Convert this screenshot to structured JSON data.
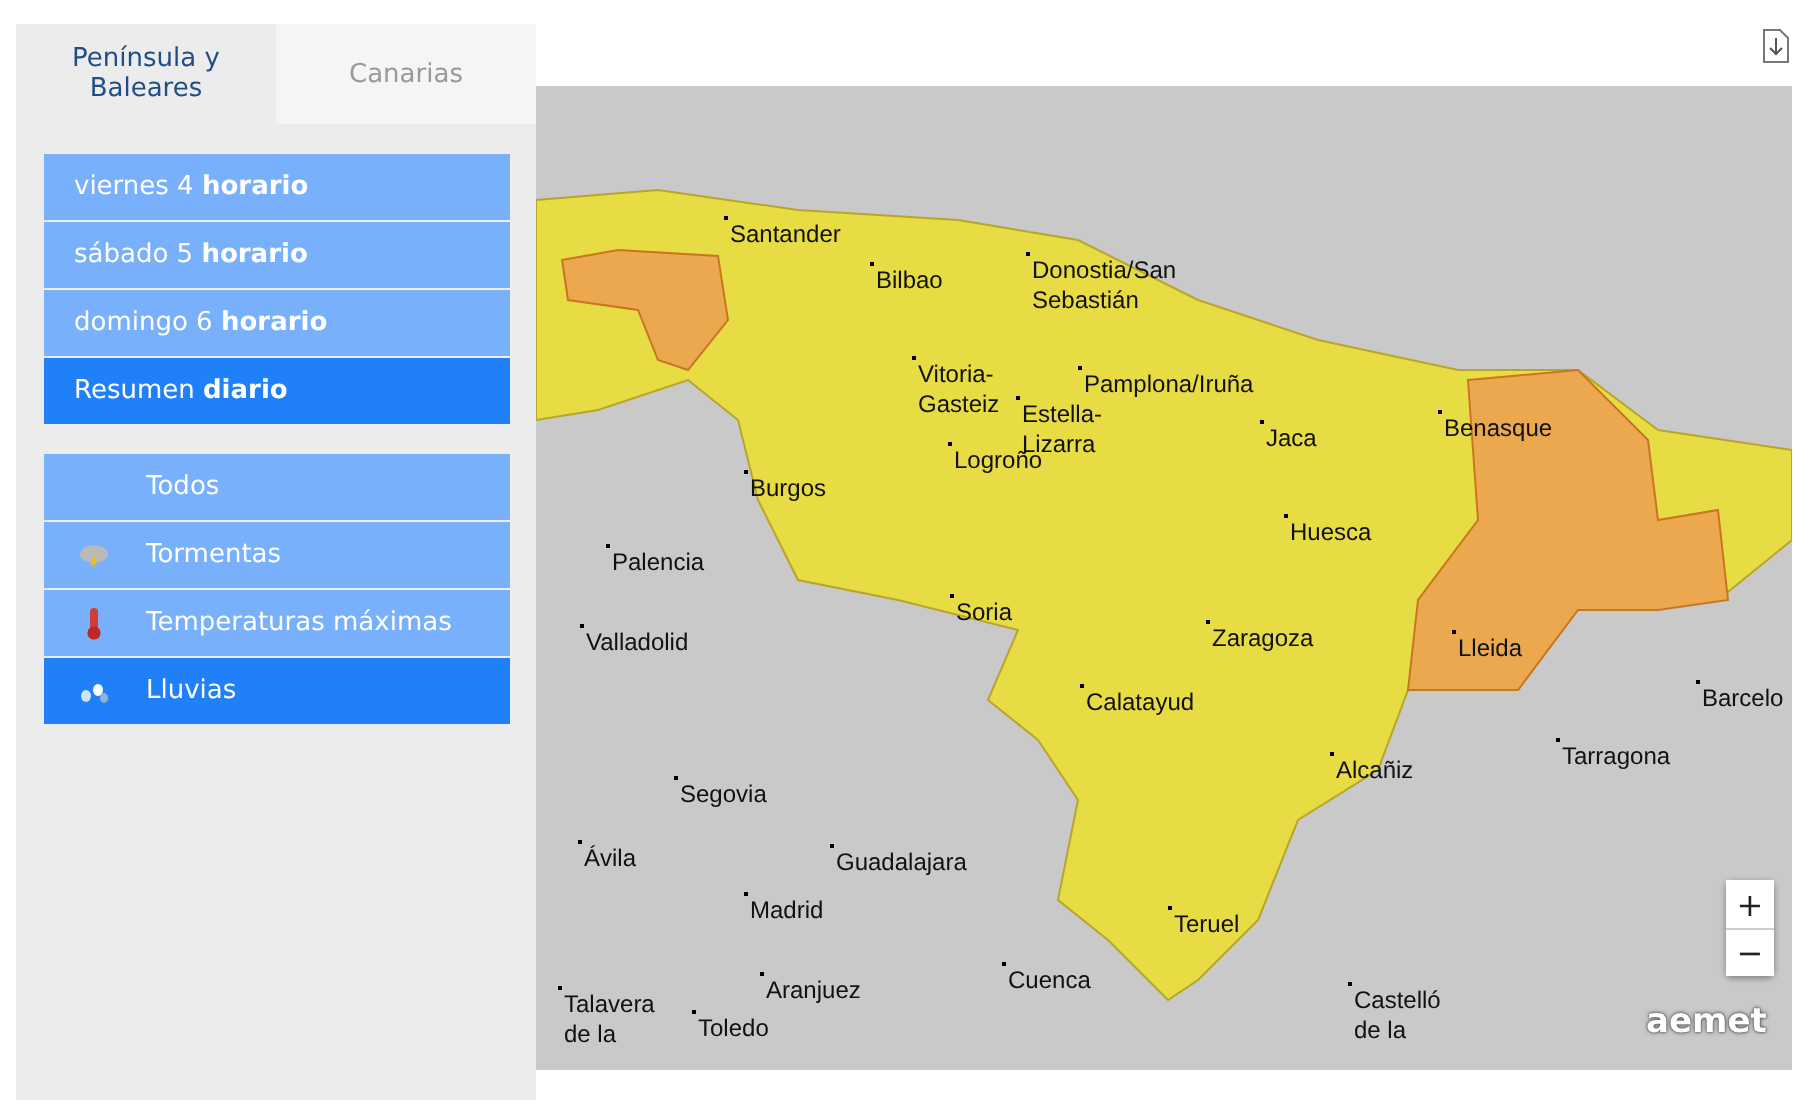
{
  "tabs": [
    {
      "label": "Península y Baleares",
      "selected": true
    },
    {
      "label": "Canarias",
      "selected": false
    }
  ],
  "days": [
    {
      "label": "viernes 4 **horario**",
      "selected": false
    },
    {
      "label": "sábado 5 **horario**",
      "selected": false
    },
    {
      "label": "domingo 6 **horario**",
      "selected": false
    },
    {
      "label": "Resumen **diario**",
      "selected": true
    }
  ],
  "phenomena": [
    {
      "label": "Todos",
      "kind": "none",
      "selected": false
    },
    {
      "label": "Tormentas",
      "kind": "storm",
      "selected": false
    },
    {
      "label": "Temperaturas máximas",
      "kind": "heat",
      "selected": false
    },
    {
      "label": "Lluvias",
      "kind": "rain",
      "selected": true
    }
  ],
  "map": {
    "cities": [
      "Santander",
      "Bilbao",
      "Donostia/San Sebastián",
      "Vitoria-Gasteiz",
      "Pamplona/Iruña",
      "Estella-Lizarra",
      "Jaca",
      "Benasque",
      "Logroño",
      "Burgos",
      "Huesca",
      "Palencia",
      "Soria",
      "Valladolid",
      "Zaragoza",
      "Lleida",
      "Barcelo",
      "Calatayud",
      "Alcañiz",
      "Tarragona",
      "Segovia",
      "Ávila",
      "Guadalajara",
      "Madrid",
      "Teruel",
      "Talavera de la",
      "Aranjuez",
      "Toledo",
      "Cuenca",
      "Castelló de la"
    ],
    "zoom_in": "+",
    "zoom_out": "−",
    "logo": "aemet"
  }
}
